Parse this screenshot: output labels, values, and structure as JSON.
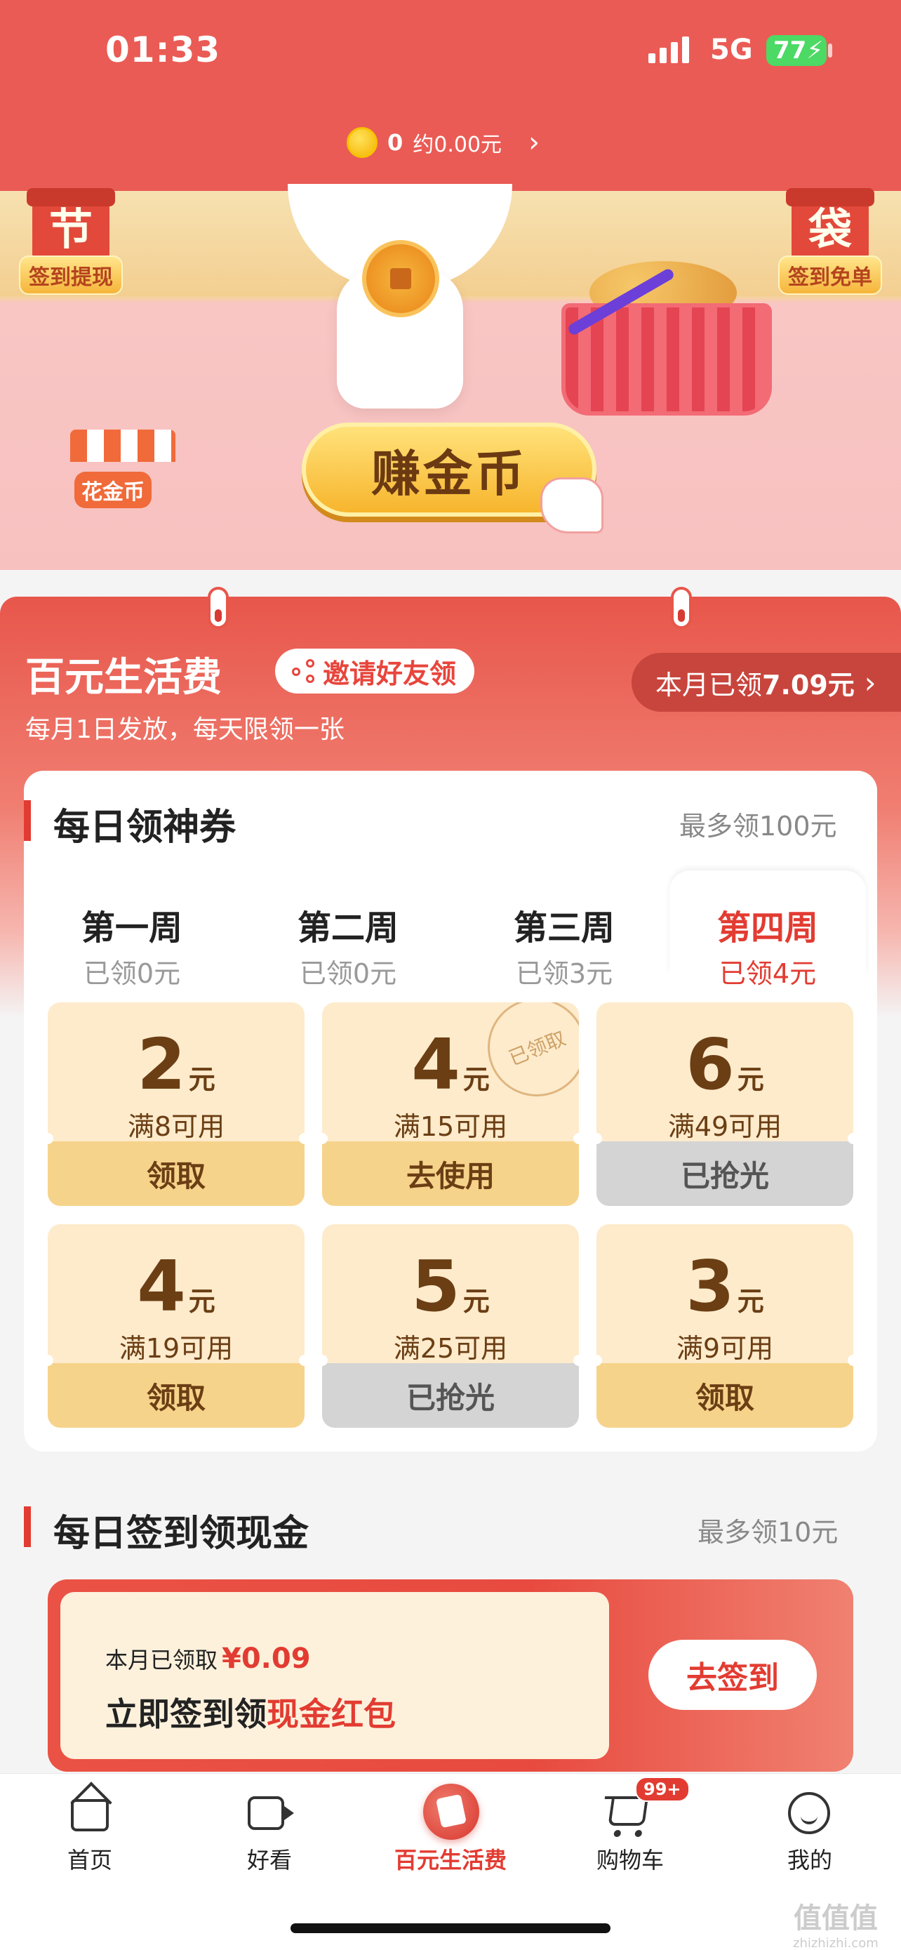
{
  "status": {
    "time": "01:33",
    "network": "5G",
    "battery": "77"
  },
  "header": {
    "coins": "0",
    "coins_value": "约0.00元",
    "chevron": "›"
  },
  "hero": {
    "left_badge_char": "节",
    "left_badge_label": "签到提现",
    "right_badge_char": "袋",
    "right_badge_label": "签到免单",
    "shop_label": "花金币",
    "earn_button": "赚金币"
  },
  "section": {
    "title": "百元生活费",
    "invite_button": "邀请好友领",
    "monthly_label": "本月已领",
    "monthly_value": "7.09元",
    "monthly_chevron": "›",
    "subtitle": "每月1日发放，每天限领一张"
  },
  "daily_coupon": {
    "title": "每日领神券",
    "max_label": "最多领100元",
    "weeks": [
      {
        "name": "第一周",
        "status": "已领0元"
      },
      {
        "name": "第二周",
        "status": "已领0元"
      },
      {
        "name": "第三周",
        "status": "已领3元"
      },
      {
        "name": "第四周",
        "status": "已领4元"
      }
    ],
    "coupons": [
      {
        "amount": "2",
        "unit": "元",
        "condition": "满8可用",
        "action": "领取"
      },
      {
        "amount": "4",
        "unit": "元",
        "condition": "满15可用",
        "action": "去使用",
        "stamp": "已领取"
      },
      {
        "amount": "6",
        "unit": "元",
        "condition": "满49可用",
        "action": "已抢光"
      },
      {
        "amount": "4",
        "unit": "元",
        "condition": "满19可用",
        "action": "领取"
      },
      {
        "amount": "5",
        "unit": "元",
        "condition": "满25可用",
        "action": "已抢光"
      },
      {
        "amount": "3",
        "unit": "元",
        "condition": "满9可用",
        "action": "领取"
      }
    ]
  },
  "daily_sign": {
    "title": "每日签到领现金",
    "max_label": "最多领10元",
    "month_label": "本月已领取",
    "month_value": "¥0.09",
    "line_prefix": "立即签到领",
    "line_highlight": "现金红包",
    "button": "去签到"
  },
  "tabbar": {
    "items": [
      {
        "label": "首页",
        "icon": "home-icon"
      },
      {
        "label": "好看",
        "icon": "video-icon"
      },
      {
        "label": "百元生活费",
        "icon": "red-envelope-icon"
      },
      {
        "label": "购物车",
        "icon": "cart-icon",
        "badge": "99+"
      },
      {
        "label": "我的",
        "icon": "smile-icon"
      }
    ]
  },
  "watermark": {
    "text": "值值值",
    "url": "zhizhizhi.com"
  },
  "colors": {
    "brand_red": "#e23c32",
    "header_red": "#ea5b55",
    "coupon_bg": "#fdebcc",
    "coupon_action": "#f6d38b",
    "sold_out": "#d4d4d4"
  }
}
